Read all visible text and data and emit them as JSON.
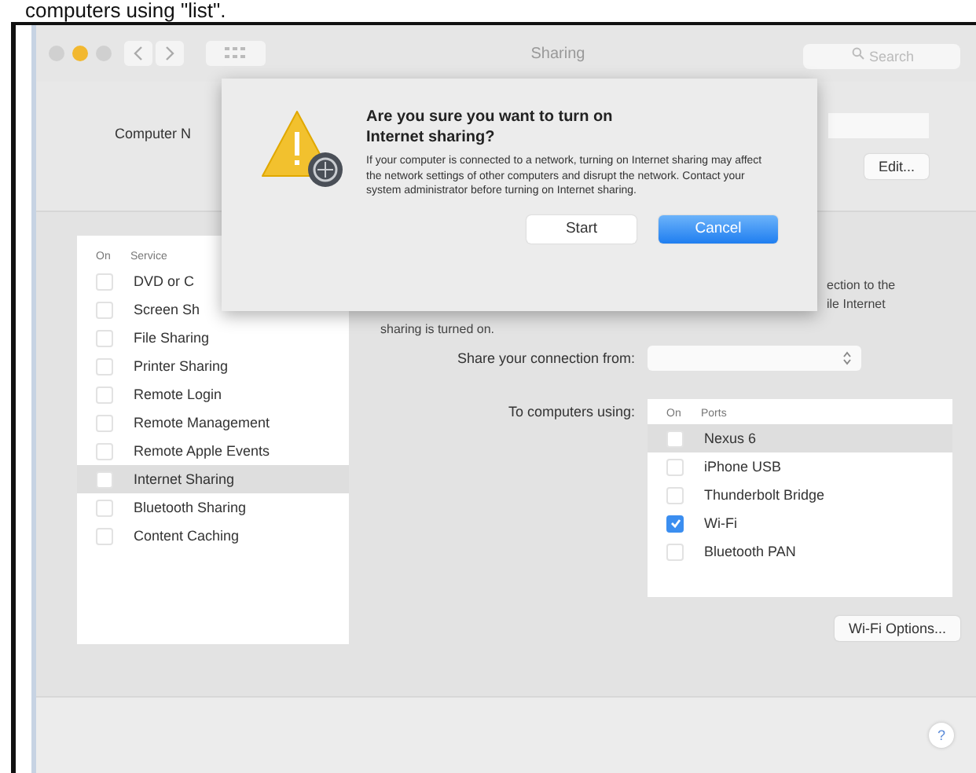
{
  "caption": "computers using \"list\".",
  "window": {
    "title": "Sharing",
    "search_placeholder": "Search"
  },
  "computer_name": {
    "label": "Computer N",
    "edit_button": "Edit..."
  },
  "services": {
    "columns": [
      "On",
      "Service"
    ],
    "items": [
      {
        "name": "DVD or C",
        "checked": false,
        "selected": false
      },
      {
        "name": "Screen Sh",
        "checked": false,
        "selected": false
      },
      {
        "name": "File Sharing",
        "checked": false,
        "selected": false
      },
      {
        "name": "Printer Sharing",
        "checked": false,
        "selected": false
      },
      {
        "name": "Remote Login",
        "checked": false,
        "selected": false
      },
      {
        "name": "Remote Management",
        "checked": false,
        "selected": false
      },
      {
        "name": "Remote Apple Events",
        "checked": false,
        "selected": false
      },
      {
        "name": "Internet Sharing",
        "checked": false,
        "selected": true
      },
      {
        "name": "Bluetooth Sharing",
        "checked": false,
        "selected": false
      },
      {
        "name": "Content Caching",
        "checked": false,
        "selected": false
      }
    ]
  },
  "detail": {
    "description_lines": [
      "ection to the",
      "ile Internet"
    ],
    "status_line": "sharing is turned on.",
    "share_from_label": "Share your connection from:",
    "to_label": "To computers using:",
    "ports": {
      "columns": [
        "On",
        "Ports"
      ],
      "items": [
        {
          "name": "Nexus 6",
          "checked": false,
          "selected": true
        },
        {
          "name": "iPhone USB",
          "checked": false,
          "selected": false
        },
        {
          "name": "Thunderbolt Bridge",
          "checked": false,
          "selected": false
        },
        {
          "name": "Wi-Fi",
          "checked": true,
          "selected": false
        },
        {
          "name": "Bluetooth PAN",
          "checked": false,
          "selected": false
        }
      ]
    },
    "options_button": "Wi-Fi Options..."
  },
  "dialog": {
    "title": "Are you sure you want to turn on Internet sharing?",
    "message": "If your computer is connected to a network, turning on Internet sharing may affect the network settings of other computers and disrupt the network. Contact your system administrator before turning on Internet sharing.",
    "buttons": [
      {
        "label": "Start",
        "default": false
      },
      {
        "label": "Cancel",
        "default": true
      }
    ]
  },
  "help": "?"
}
